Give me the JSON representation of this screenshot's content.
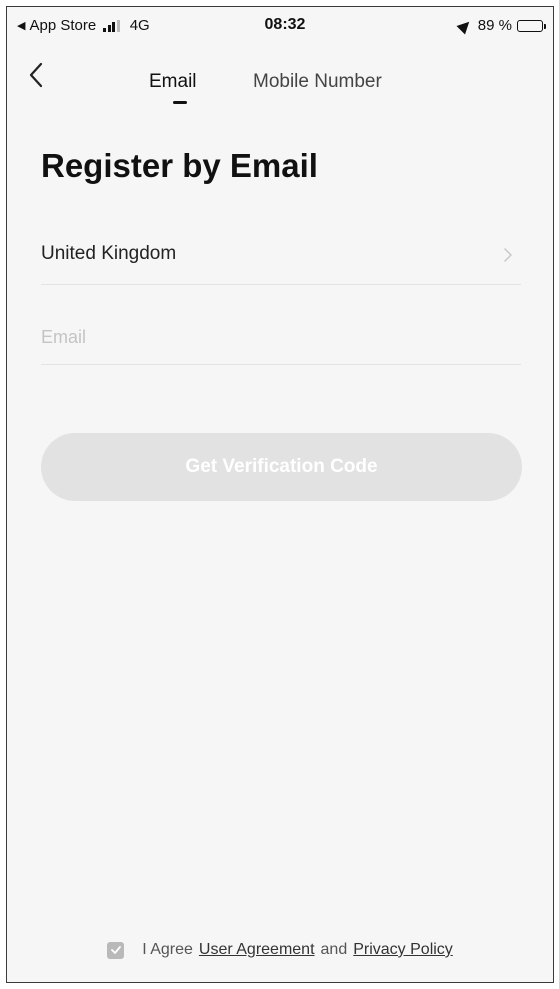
{
  "status_bar": {
    "back_app": "App Store",
    "network": "4G",
    "time": "08:32",
    "battery": "89 %",
    "battery_level": 0.89
  },
  "nav": {
    "tabs": [
      {
        "label": "Email",
        "active": true
      },
      {
        "label": "Mobile Number",
        "active": false
      }
    ]
  },
  "main": {
    "title": "Register by Email",
    "country": "United Kingdom",
    "email_placeholder": "Email",
    "email_value": "",
    "verify_button": "Get Verification Code"
  },
  "agreement": {
    "prefix": "I Agree",
    "user_agreement": "User Agreement",
    "conjunction": "and",
    "privacy_policy": "Privacy Policy",
    "checked": true
  },
  "colors": {
    "button_disabled": "#e2e2e2",
    "background": "#f6f6f6",
    "text": "#111111"
  }
}
